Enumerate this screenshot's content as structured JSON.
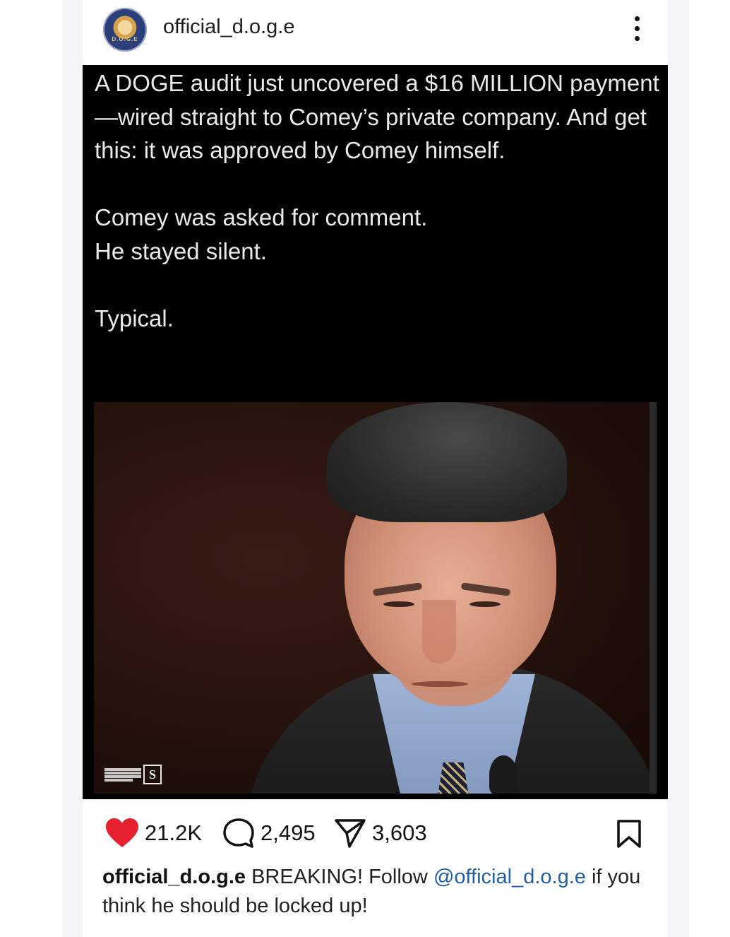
{
  "post": {
    "username": "official_d.o.g.e",
    "tweet": {
      "paragraphs": [
        "A DOGE audit just uncovered a $16 MILLION payment—wired straight to Comey’s private company. And get this: it was approved by Comey himself.",
        "Comey was asked for comment.",
        "He stayed silent.",
        "Typical."
      ]
    },
    "watermark": {
      "letter": "S"
    },
    "actions": {
      "likes": "21.2K",
      "comments": "2,495",
      "shares": "3,603"
    },
    "caption": {
      "username": "official_d.o.g.e",
      "text_before": "BREAKING! Follow",
      "mention": "@official_d.o.g.e",
      "text_after": "if you think he should be locked up!"
    }
  },
  "colors": {
    "like": "#e6202e",
    "mention": "#1f5fa8",
    "tweet_bg": "#000000"
  },
  "icons": {
    "more": "more-vertical-icon",
    "like": "heart-icon",
    "comment": "comment-bubble-icon",
    "share": "send-icon",
    "bookmark": "bookmark-icon"
  }
}
